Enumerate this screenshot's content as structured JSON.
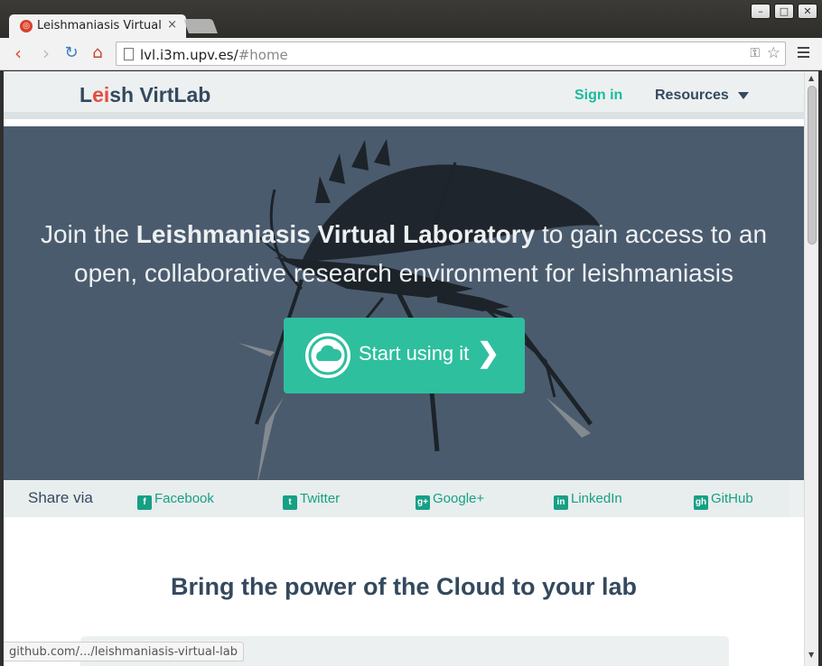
{
  "browser": {
    "tab_title": "Leishmaniasis Virtual",
    "tab_close": "×",
    "window_minimize": "–",
    "window_maximize": "□",
    "window_close": "✕",
    "url_host": "lvl.i3m.upv.es/",
    "url_path": "#home",
    "status_url": "github.com/.../leishmaniasis-virtual-lab"
  },
  "nav": {
    "logo_l": "L",
    "logo_ei": "ei",
    "logo_rest": "sh VirtLab",
    "signin": "Sign in",
    "resources": "Resources"
  },
  "hero": {
    "text_pre": "Join the ",
    "text_bold": "Leishmaniasis Virtual Laboratory",
    "text_post": " to gain access to an open, collaborative research environment for leishmaniasis",
    "cta_label": "Start using it",
    "cta_chevron": "❯"
  },
  "share": {
    "label": "Share via",
    "links": [
      {
        "label": "Facebook",
        "icon": "f"
      },
      {
        "label": "Twitter",
        "icon": "t"
      },
      {
        "label": "Google+",
        "icon": "g+"
      },
      {
        "label": "LinkedIn",
        "icon": "in"
      },
      {
        "label": "GitHub",
        "icon": "gh"
      }
    ]
  },
  "section": {
    "title": "Bring the power of the Cloud to your lab"
  },
  "colors": {
    "accent": "#1abc9c",
    "hero_bg": "#4b5b6e",
    "text_dark": "#34495e",
    "logo_red": "#e74c3c"
  }
}
